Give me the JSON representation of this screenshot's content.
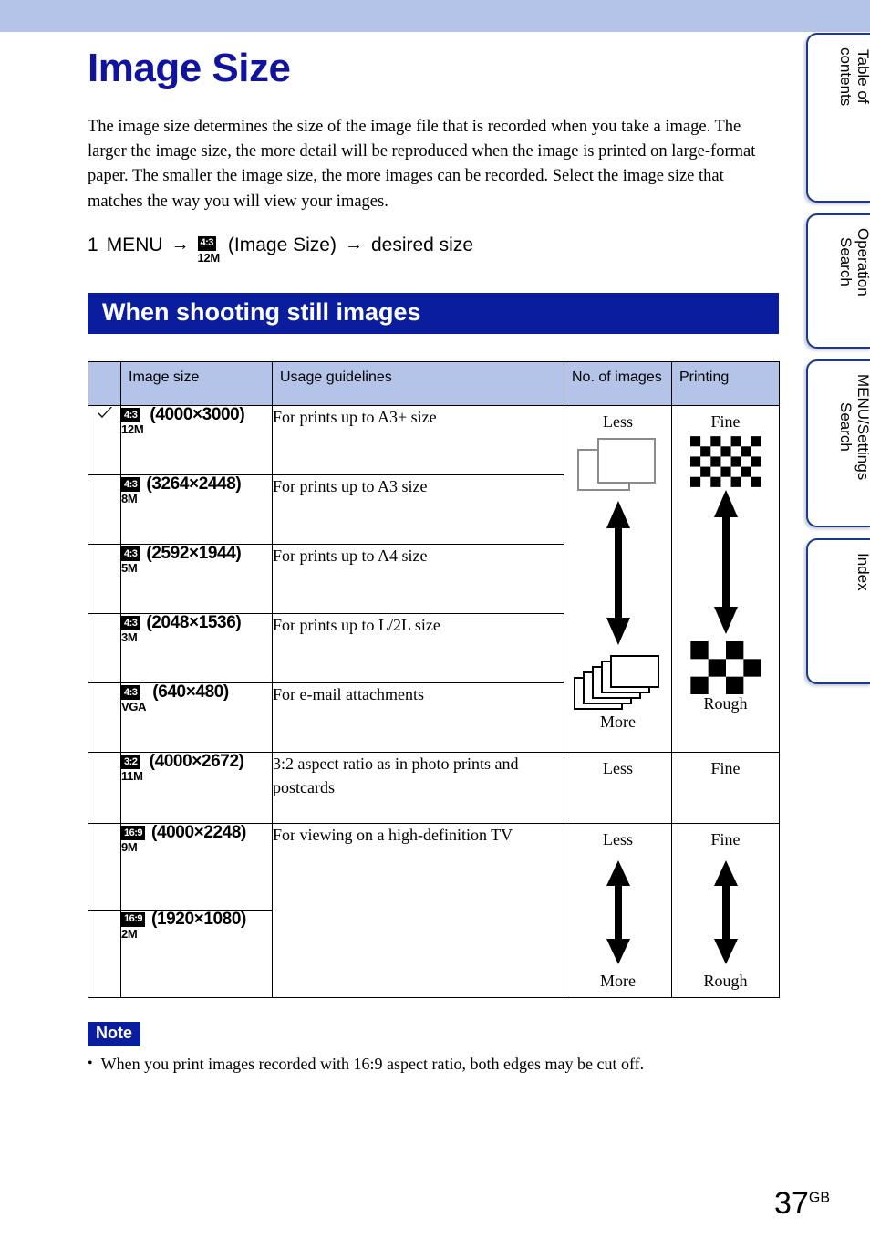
{
  "document": {
    "title": "Image Size",
    "intro": "The image size determines the size of the image file that is recorded when you take a image. The larger the image size, the more detail will be reproduced when the image is printed on large-format paper. The smaller the image size, the more images can be recorded. Select the image size that matches the way you will view your images.",
    "page_number": "37",
    "page_suffix": "GB"
  },
  "step": {
    "number": "1",
    "menu_label": "MENU",
    "arrow": "→",
    "icon_aspect": "4:3",
    "icon_mp": "12M",
    "setting_label": "(Image Size)",
    "arrow2": "→",
    "result_label": "desired size"
  },
  "section": {
    "heading": "When shooting still images"
  },
  "table": {
    "headers": {
      "check": "",
      "size": "Image size",
      "usage": "Usage guidelines",
      "number": "No. of images",
      "printing": "Printing"
    },
    "rows": [
      {
        "checked": true,
        "aspect": "4:3",
        "mp": "12M",
        "dimensions": "(4000×3000)",
        "usage": "For prints up to A3+ size"
      },
      {
        "checked": false,
        "aspect": "4:3",
        "mp": "8M",
        "dimensions": "(3264×2448)",
        "usage": "For prints up to A3 size"
      },
      {
        "checked": false,
        "aspect": "4:3",
        "mp": "5M",
        "dimensions": "(2592×1944)",
        "usage": "For prints up to A4 size"
      },
      {
        "checked": false,
        "aspect": "4:3",
        "mp": "3M",
        "dimensions": "(2048×1536)",
        "usage": "For prints up to L/2L size"
      },
      {
        "checked": false,
        "aspect": "4:3",
        "mp": "VGA",
        "dimensions": "(640×480)",
        "usage": "For e-mail attachments"
      },
      {
        "checked": false,
        "aspect": "3:2",
        "mp": "11M",
        "dimensions": "(4000×2672)",
        "usage": "3:2 aspect ratio as in photo prints and postcards"
      },
      {
        "checked": false,
        "aspect": "16:9",
        "mp": "9M",
        "dimensions": "(4000×2248)",
        "usage": "For viewing on a high-definition TV"
      },
      {
        "checked": false,
        "aspect": "16:9",
        "mp": "2M",
        "dimensions": "(1920×1080)",
        "usage": ""
      }
    ],
    "scales": {
      "number_top": "Less",
      "number_bottom": "More",
      "printing_top": "Fine",
      "printing_bottom": "Rough"
    }
  },
  "note": {
    "badge": "Note",
    "bullet": "•",
    "text": "When you print images recorded with 16:9 aspect ratio, both edges may be cut off."
  },
  "tabs": [
    {
      "label": "Table of\ncontents"
    },
    {
      "label": "Operation\nSearch"
    },
    {
      "label": "MENU/Settings\nSearch"
    },
    {
      "label": "Index"
    }
  ],
  "colors": {
    "band": "#b4c3e8",
    "title": "#10139e",
    "section_bar": "#0a1d9e",
    "table_header": "#b4c3e8",
    "tab_border": "#1b3a8c"
  }
}
